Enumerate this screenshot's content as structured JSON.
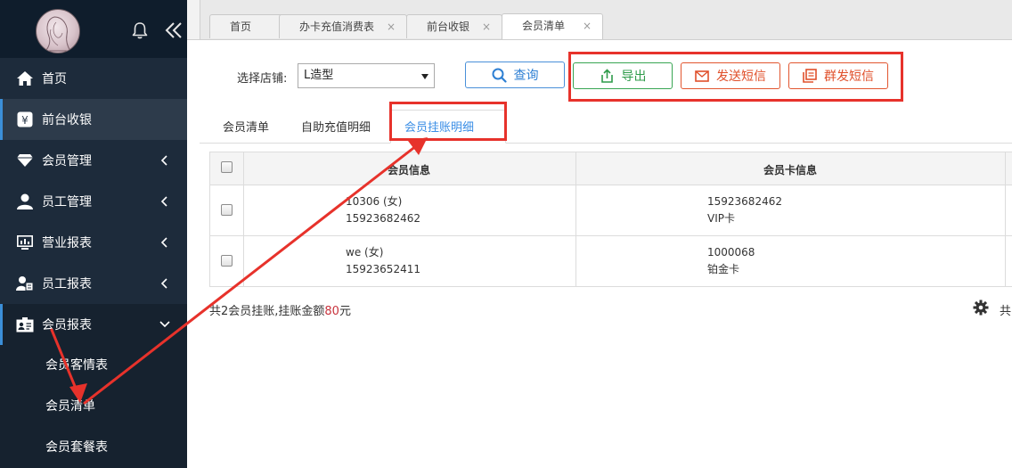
{
  "sidebar": {
    "menu": [
      {
        "label": "首页",
        "icon": "home-icon"
      },
      {
        "label": "前台收银",
        "icon": "yen-icon"
      },
      {
        "label": "会员管理",
        "icon": "diamond-icon"
      },
      {
        "label": "员工管理",
        "icon": "user-icon"
      },
      {
        "label": "营业报表",
        "icon": "monitor-chart-icon"
      },
      {
        "label": "员工报表",
        "icon": "user-card-icon"
      },
      {
        "label": "会员报表",
        "icon": "id-card-icon"
      }
    ],
    "submenu": [
      "会员客情表",
      "会员清单",
      "会员套餐表"
    ]
  },
  "tabs": [
    {
      "label": "首页"
    },
    {
      "label": "办卡充值消费表",
      "close": "×"
    },
    {
      "label": "前台收银",
      "close": "×"
    },
    {
      "label": "会员清单",
      "close": "×"
    }
  ],
  "filter": {
    "store_label": "选择店铺:",
    "store_value": "L造型"
  },
  "buttons": {
    "query": "查询",
    "export": "导出",
    "send_sms": "发送短信",
    "bulk_sms": "群发短信"
  },
  "subtabs": [
    "会员清单",
    "自助充值明细",
    "会员挂账明细"
  ],
  "table": {
    "columns": [
      "会员信息",
      "会员卡信息"
    ],
    "rows": [
      {
        "member_line1": "10306 (女)",
        "member_line2": "15923682462",
        "card_line1": "15923682462",
        "card_line2": "VIP卡"
      },
      {
        "member_line1": "we (女)",
        "member_line2": "15923652411",
        "card_line1": "1000068",
        "card_line2": "铂金卡"
      }
    ]
  },
  "summary": {
    "prefix": "共2会员挂账,挂账金额",
    "amount": "80",
    "suffix": "元",
    "right": "共"
  },
  "colors": {
    "accent": "#3a8ee6",
    "annotation": "#e7322b",
    "amount": "#c8323c"
  }
}
